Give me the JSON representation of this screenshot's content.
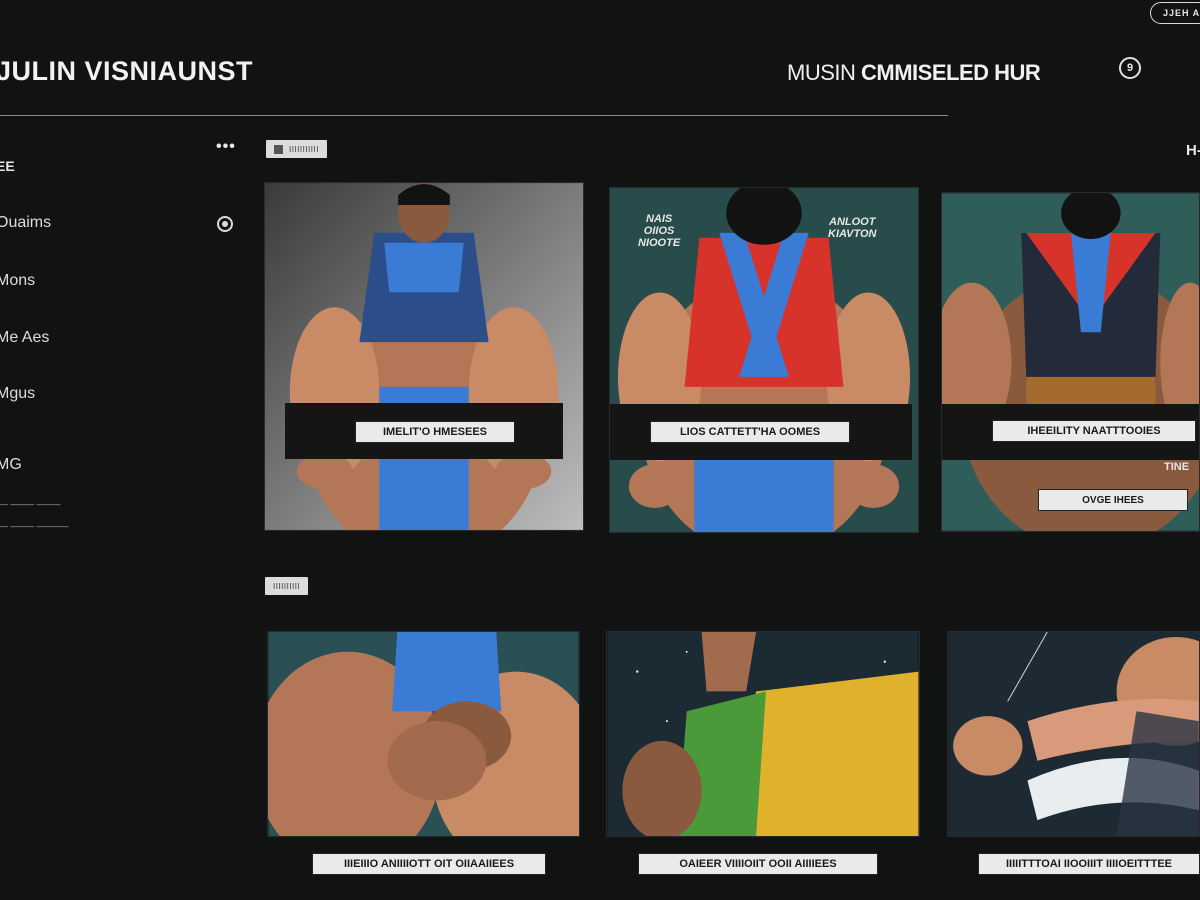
{
  "top_right_pill": "JJEH AE",
  "header": {
    "app_title": "JULIN VISNIAUNST",
    "section_title_light": "MUSIN",
    "section_title_bold": "CMMISELED HUR",
    "account_icon_glyph": "9"
  },
  "sidebar": {
    "heading": "EE",
    "more_glyph": "•••",
    "items": [
      "Ouaims",
      "Mons",
      "Me Aes",
      "Mgus",
      "MG"
    ],
    "small_links": [
      "— ——— ———",
      "— ——— ————"
    ]
  },
  "gallery": {
    "row1_chip": "IIIIIIIIIII",
    "row2_chip": "IIIIIIIIII",
    "right_hint": "H-",
    "row1_cards": [
      {
        "caption": "IMELIT'O HMESEES",
        "palette": "gray",
        "top": "blue"
      },
      {
        "caption": "LIOS CATTETT'HA OOMES",
        "palette": "teal",
        "top": "red-blue",
        "tag": "ANLOOT\nKIAVTON",
        "tag_left": "NAIS\nOIIOS\nNIOOTE"
      },
      {
        "caption": "IHEEILITY NAATTTOOIES",
        "palette": "teal",
        "top": "red-blue",
        "subcaption": "OVGE IHEES",
        "side_tag": "TINE"
      }
    ],
    "row2_cards": [
      {
        "caption": "IIIEIIIO ANIIIIOTT OIT OIIAAIIEES",
        "palette": "tealdark",
        "top": "blue"
      },
      {
        "caption": "OAIEER VIIIIOIIT OOII AIIIIEES",
        "palette": "space",
        "top": "yellow-green"
      },
      {
        "caption": "IIIIITTTOAI IIOOIIIT IIIIOEITTTEE",
        "palette": "space",
        "top": "white"
      }
    ]
  },
  "colors": {
    "background": "#111212",
    "blue_top": "#3a7bd5",
    "red_top": "#d8332b",
    "skin": "#c98a66",
    "teal_bg": "#2f5d5a"
  }
}
